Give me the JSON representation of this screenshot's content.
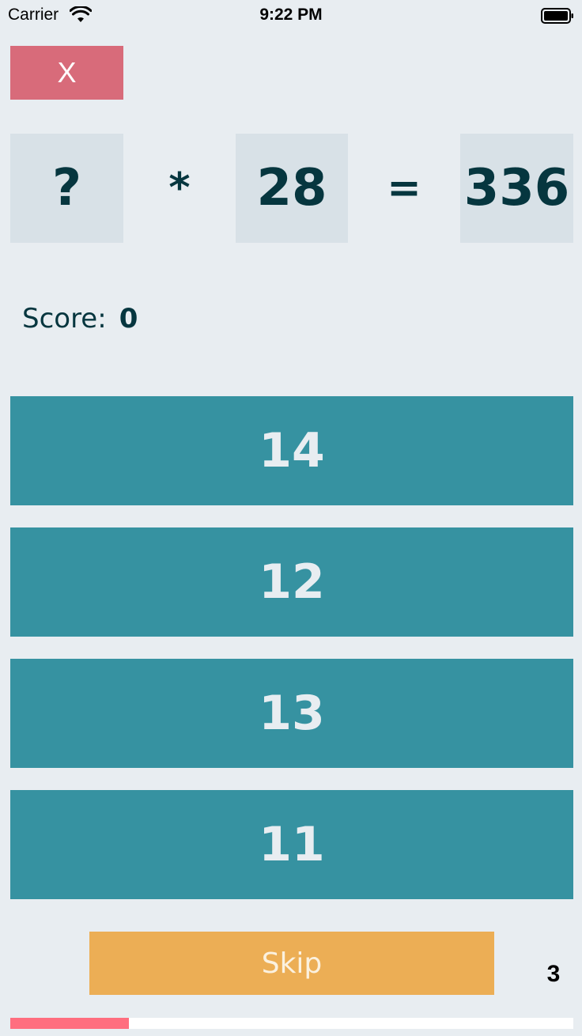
{
  "status_bar": {
    "carrier": "Carrier",
    "time": "9:22 PM",
    "wifi_icon": "wifi-icon",
    "battery_icon": "battery-icon"
  },
  "close_button": {
    "label": "X",
    "color": "#d86b7a"
  },
  "equation": {
    "unknown": "?",
    "operator": "*",
    "operand": "28",
    "equals": "=",
    "result": "336"
  },
  "score": {
    "label": "Score:",
    "value": "0"
  },
  "answers": [
    {
      "label": "14"
    },
    {
      "label": "12"
    },
    {
      "label": "13"
    },
    {
      "label": "11"
    }
  ],
  "skip": {
    "label": "Skip",
    "color": "#ecae55"
  },
  "timer": {
    "count": "3"
  },
  "progress": {
    "fraction": 0.21,
    "fill_color": "#ff6e7f",
    "track_color": "#ffffff"
  },
  "colors": {
    "background": "#e8edf1",
    "answer_button": "#3692a1",
    "text_dark": "#06363f"
  }
}
